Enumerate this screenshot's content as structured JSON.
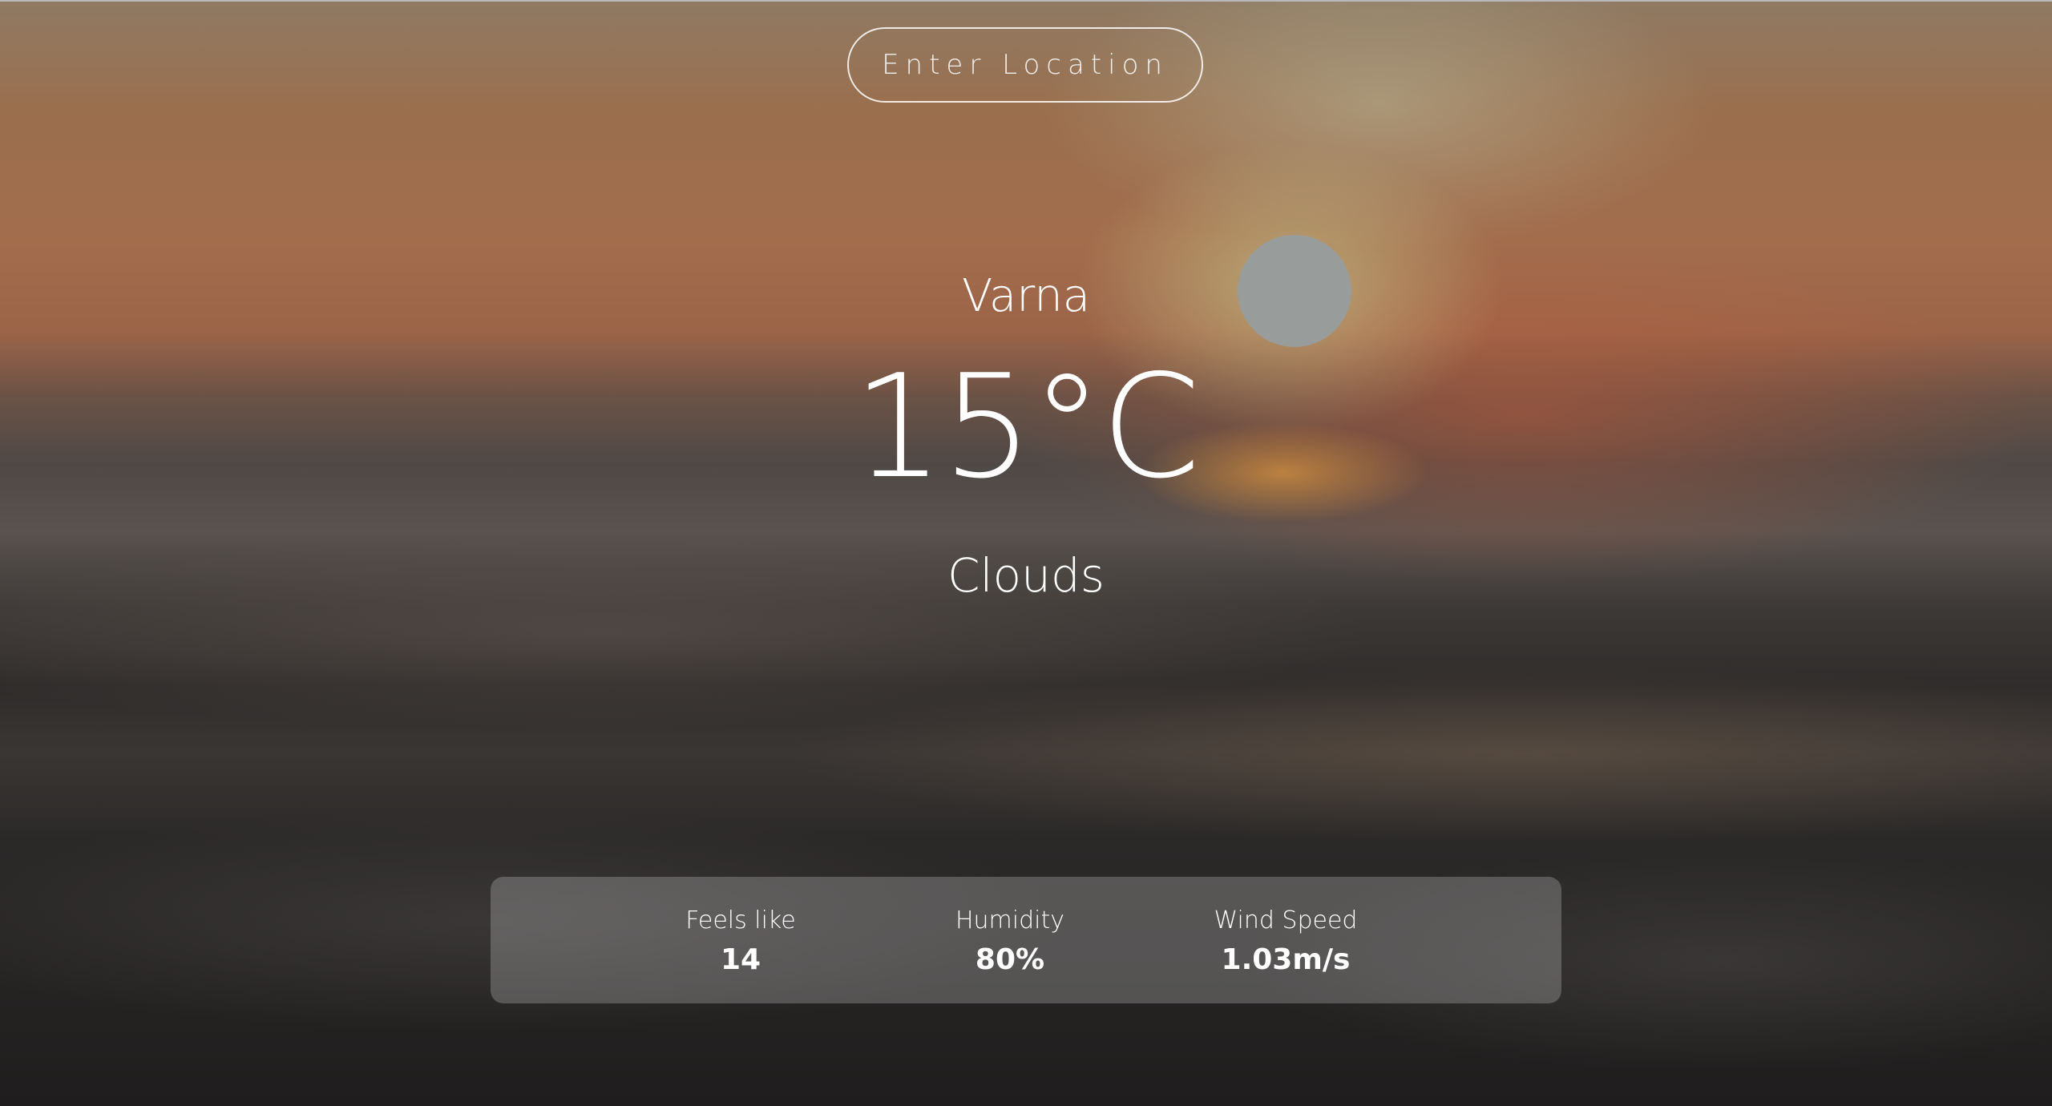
{
  "search": {
    "placeholder": "Enter Location"
  },
  "current": {
    "city": "Varna",
    "temperature": "15°C",
    "condition": "Clouds"
  },
  "details": {
    "feels_like_label": "Feels like",
    "feels_like_value": "14",
    "humidity_label": "Humidity",
    "humidity_value": "80%",
    "wind_label": "Wind Speed",
    "wind_value": "1.03m/s"
  }
}
